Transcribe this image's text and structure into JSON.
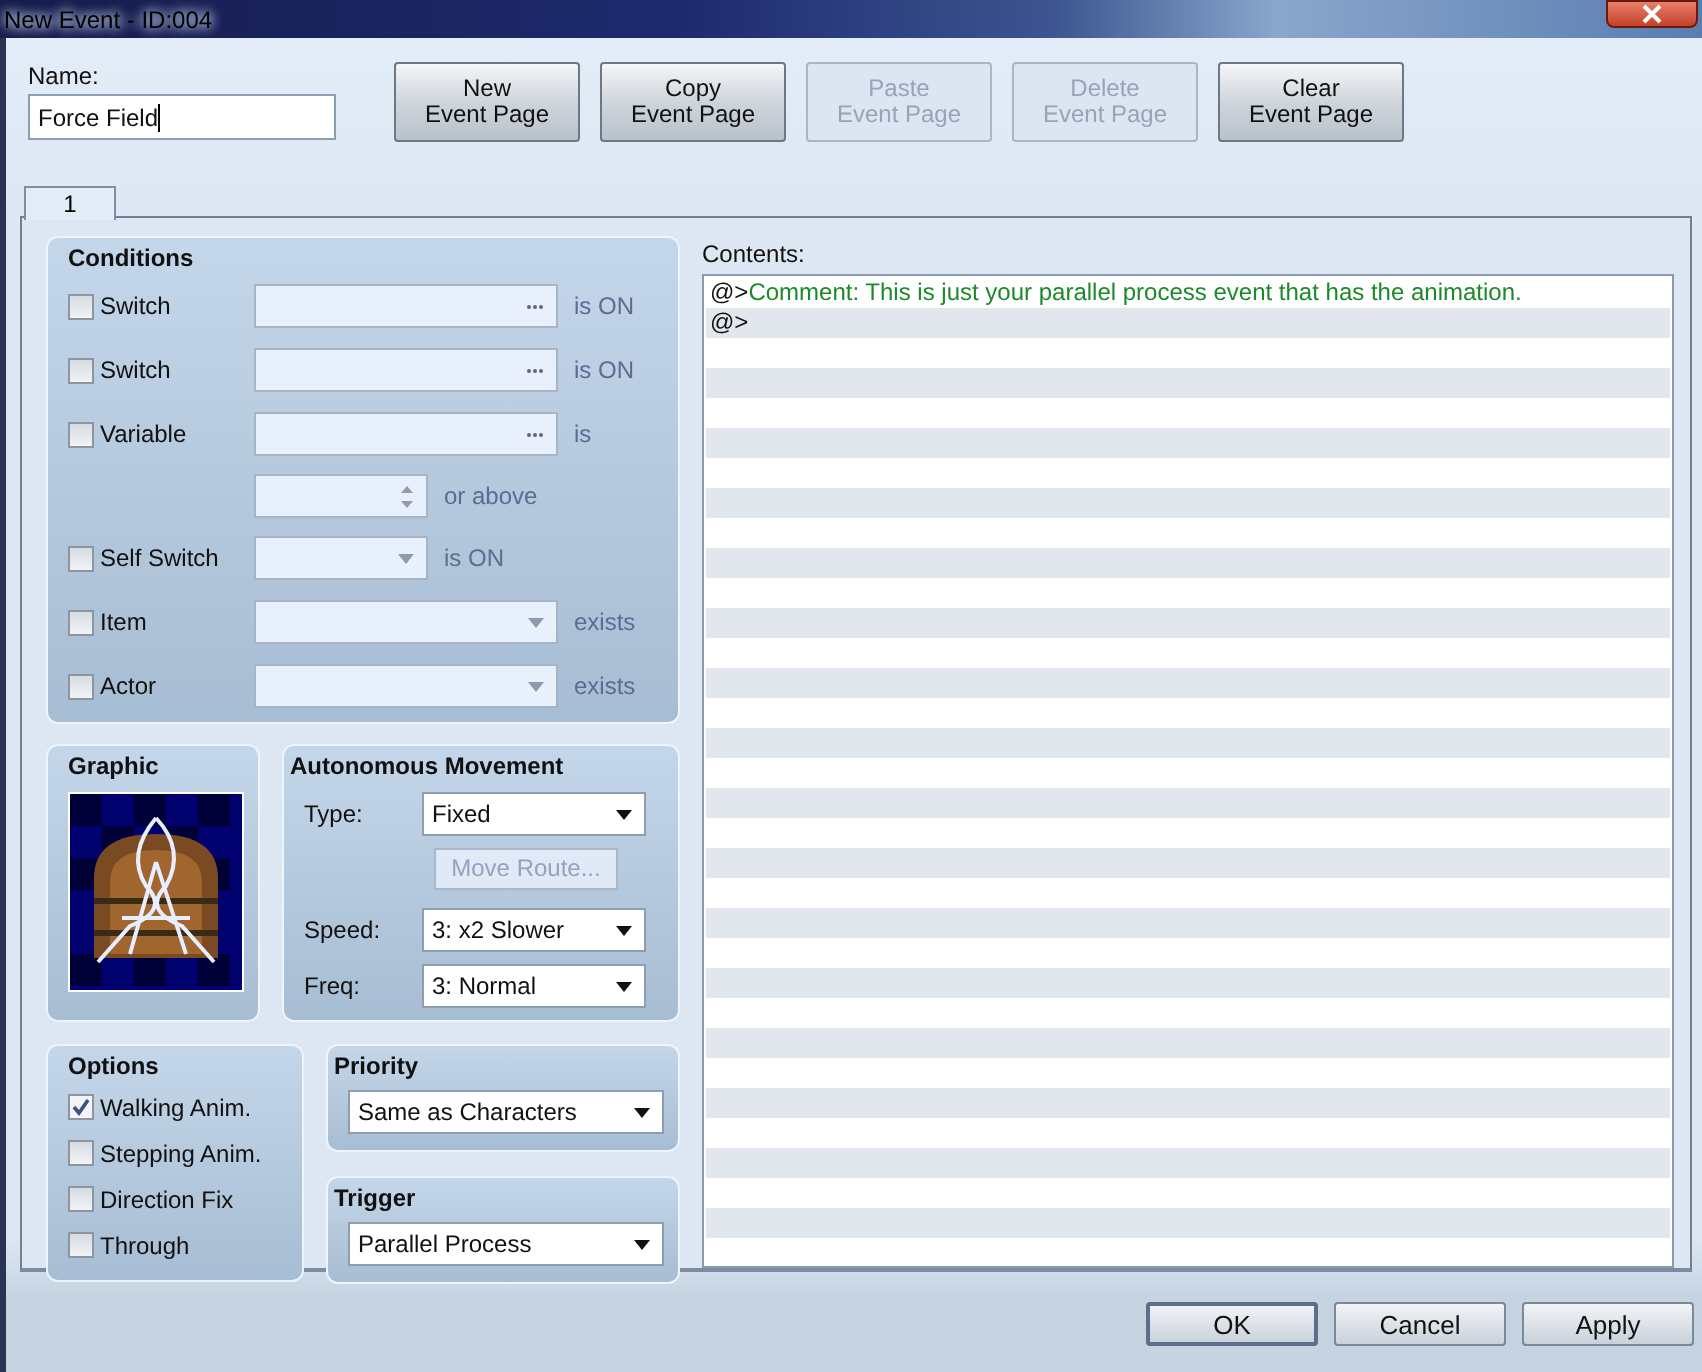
{
  "window": {
    "title": "New Event - ID:004"
  },
  "name_field": {
    "label": "Name:",
    "value": "Force Field"
  },
  "page_buttons": [
    {
      "lines": [
        "New",
        "Event Page"
      ],
      "disabled": false
    },
    {
      "lines": [
        "Copy",
        "Event Page"
      ],
      "disabled": false
    },
    {
      "lines": [
        "Paste",
        "Event Page"
      ],
      "disabled": true
    },
    {
      "lines": [
        "Delete",
        "Event Page"
      ],
      "disabled": true
    },
    {
      "lines": [
        "Clear",
        "Event Page"
      ],
      "disabled": false
    }
  ],
  "tabs": [
    {
      "label": "1",
      "selected": true
    }
  ],
  "conditions": {
    "title": "Conditions",
    "rows": [
      {
        "kind": "check",
        "label": "Switch",
        "checked": false,
        "field": {
          "kind": "picker"
        },
        "suffix": "is ON"
      },
      {
        "kind": "check",
        "label": "Switch",
        "checked": false,
        "field": {
          "kind": "picker"
        },
        "suffix": "is ON"
      },
      {
        "kind": "check",
        "label": "Variable",
        "checked": false,
        "field": {
          "kind": "picker"
        },
        "suffix": "is"
      },
      {
        "kind": "spin",
        "suffix": "or above"
      },
      {
        "kind": "check",
        "label": "Self Switch",
        "checked": false,
        "field": {
          "kind": "short_dropdown"
        },
        "suffix": "is ON"
      },
      {
        "kind": "check",
        "label": "Item",
        "checked": false,
        "field": {
          "kind": "dropdown"
        },
        "suffix": "exists"
      },
      {
        "kind": "check",
        "label": "Actor",
        "checked": false,
        "field": {
          "kind": "dropdown"
        },
        "suffix": "exists"
      }
    ]
  },
  "graphic": {
    "title": "Graphic"
  },
  "movement": {
    "title": "Autonomous Movement",
    "selects": [
      {
        "label": "Type:",
        "value": "Fixed"
      }
    ],
    "route_button": {
      "label": "Move Route...",
      "disabled": true
    },
    "selects_after": [
      {
        "label": "Speed:",
        "value": "3: x2 Slower"
      },
      {
        "label": "Freq:",
        "value": "3: Normal"
      }
    ]
  },
  "options": {
    "title": "Options",
    "items": [
      {
        "label": "Walking Anim.",
        "checked": true
      },
      {
        "label": "Stepping Anim.",
        "checked": false
      },
      {
        "label": "Direction Fix",
        "checked": false
      },
      {
        "label": "Through",
        "checked": false
      }
    ]
  },
  "priority": {
    "title": "Priority",
    "value": "Same as Characters"
  },
  "trigger": {
    "title": "Trigger",
    "value": "Parallel Process"
  },
  "contents": {
    "label": "Contents:",
    "lines": [
      {
        "kind": "comment",
        "prefix": "@>",
        "text": "Comment: This is just your parallel process event that has the animation."
      },
      {
        "kind": "blank",
        "prefix": "@>"
      }
    ]
  },
  "dialog_buttons": [
    {
      "label": "OK",
      "default": true
    },
    {
      "label": "Cancel",
      "default": false
    },
    {
      "label": "Apply",
      "default": false
    }
  ]
}
